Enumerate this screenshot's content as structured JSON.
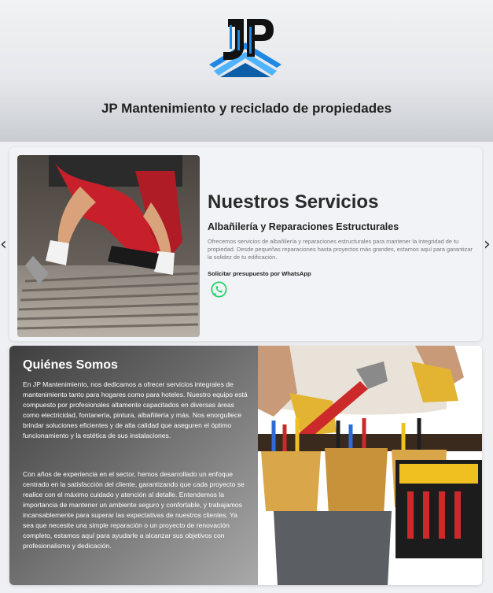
{
  "header": {
    "logo_text": "JP",
    "title": "JP Mantenimiento y reciclado de propiedades"
  },
  "carousel": {
    "prev_icon": "chevron-left-icon",
    "next_icon": "chevron-right-icon",
    "prev_glyph": "‹",
    "next_glyph": "›"
  },
  "services": {
    "heading": "Nuestros Servicios",
    "subheading": "Albañilería y Reparaciones Estructurales",
    "description": "Ofrecemos servicios de albañilería y reparaciones estructurales para mantener la integridad de tu propiedad. Desde pequeñas reparaciones hasta proyectos más grandes, estamos aquí para garantizar la solidez de tu edificación.",
    "cta": "Solicitar presupuesto por WhatsApp",
    "cta_icon": "whatsapp-icon"
  },
  "about": {
    "title": "Quiénes Somos",
    "paragraph_1": "En JP Mantenimiento, nos dedicamos a ofrecer servicios integrales de mantenimiento tanto para hogares como para hoteles. Nuestro equipo está compuesto por profesionales altamente capacitados en diversas áreas como electricidad, fontanería, pintura, albañilería y más. Nos enorgullece brindar soluciones eficientes y de alta calidad que aseguren el óptimo funcionamiento y la estética de sus instalaciones.",
    "paragraph_2": "Con años de experiencia en el sector, hemos desarrollado un enfoque centrado en la satisfacción del cliente, garantizando que cada proyecto se realice con el máximo cuidado y atención al detalle. Entendemos la importancia de mantener un ambiente seguro y confortable, y trabajamos incansablemente para superar las expectativas de nuestros clientes. Ya sea que necesite una simple reparación o un proyecto de renovación completo, estamos aquí para ayudarle a alcanzar sus objetivos con profesionalismo y dedicación."
  },
  "colors": {
    "logo_blue": "#1e88e5",
    "whatsapp_green": "#25d366",
    "about_panel_dark": "#3e3e3e"
  }
}
